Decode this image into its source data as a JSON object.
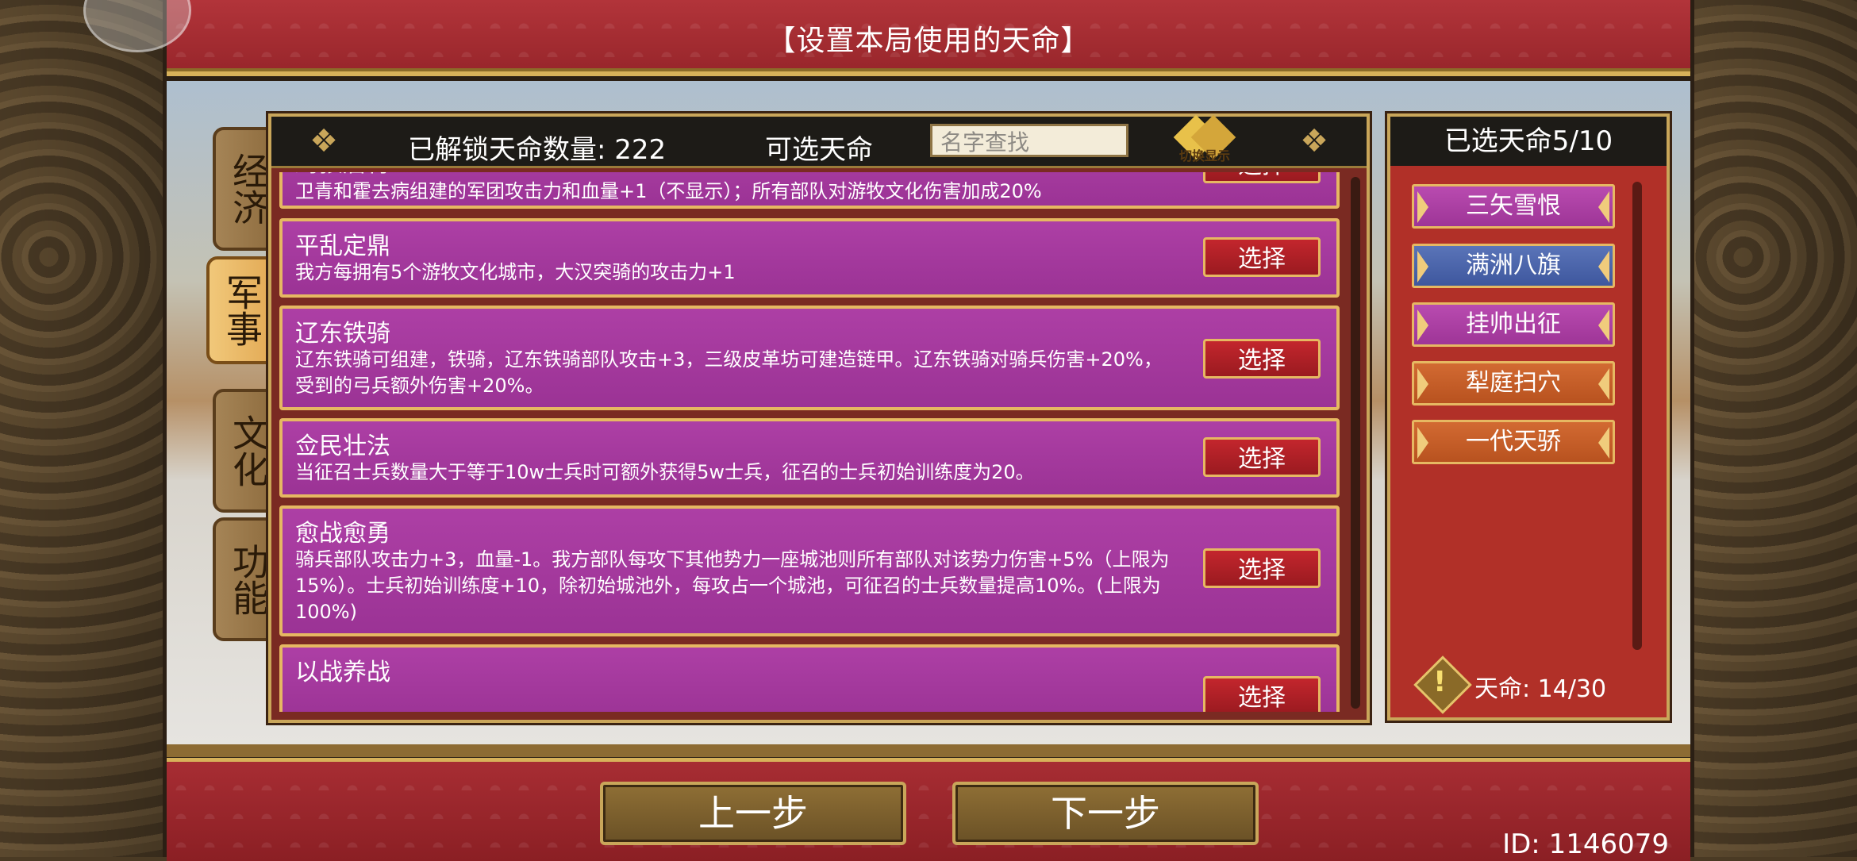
{
  "title": "【设置本局使用的天命】",
  "categories": [
    {
      "label": "经济",
      "active": false
    },
    {
      "label": "军事",
      "active": true
    },
    {
      "label": "文化",
      "active": false
    },
    {
      "label": "功能",
      "active": false
    }
  ],
  "panel": {
    "unlocked_label": "已解锁天命数量: 222",
    "selectable_label": "可选天命",
    "search_placeholder": "名字查找",
    "toggle_label": "切换显示"
  },
  "fates": [
    {
      "title": "封狼居胥",
      "desc": "卫青和霍去病组建的军团攻击力和血量+1（不显示）；所有部队对游牧文化伤害加成20%",
      "button": "选择"
    },
    {
      "title": "平乱定鼎",
      "desc": "我方每拥有5个游牧文化城市，大汉突骑的攻击力+1",
      "button": "选择"
    },
    {
      "title": "辽东铁骑",
      "desc": "辽东铁骑可组建，铁骑，辽东铁骑部队攻击+3，三级皮革坊可建造链甲。辽东铁骑对骑兵伤害+20%，受到的弓兵额外伤害+20%。",
      "button": "选择"
    },
    {
      "title": "佥民壮法",
      "desc": "当征召士兵数量大于等于10w士兵时可额外获得5w士兵，征召的士兵初始训练度为20。",
      "button": "选择"
    },
    {
      "title": "愈战愈勇",
      "desc": "骑兵部队攻击力+3，血量-1。我方部队每攻下其他势力一座城池则所有部队对该势力伤害+5%（上限为15%）。士兵初始训练度+10，除初始城池外，每攻占一个城池，可征召的士兵数量提高10%。(上限为100%)",
      "button": "选择"
    },
    {
      "title": "以战养战",
      "desc": "",
      "button": "选择"
    }
  ],
  "selected": {
    "header": "已选天命5/10",
    "items": [
      {
        "label": "三矢雪恨",
        "color": "purple"
      },
      {
        "label": "满洲八旗",
        "color": "blue"
      },
      {
        "label": "挂帅出征",
        "color": "purple"
      },
      {
        "label": "犁庭扫穴",
        "color": "orange"
      },
      {
        "label": "一代天骄",
        "color": "orange"
      }
    ],
    "fate_points": "天命: 14/30"
  },
  "nav": {
    "prev": "上一步",
    "next": "下一步"
  },
  "user_id": "ID: 1146079"
}
